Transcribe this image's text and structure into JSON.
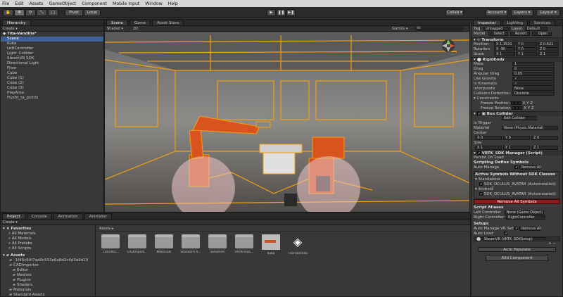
{
  "menu": [
    "File",
    "Edit",
    "Assets",
    "GameObject",
    "Component",
    "Mobile Input",
    "Window",
    "Help"
  ],
  "toolbar": {
    "tools": [
      "✋",
      "✥",
      "⟳",
      "⤡",
      "▢"
    ],
    "pivot": "Pivot",
    "local": "Local",
    "play": "▶",
    "pause": "❚❚",
    "step": "▶❚",
    "collab": "Collab ▾",
    "account": "Account ▾",
    "layers": "Layers ▾",
    "layout": "Layout ▾"
  },
  "hierarchy": {
    "tab": "Hierarchy",
    "create": "Create ▾",
    "scene": "Tita-Vandilla*",
    "items": [
      {
        "label": "Scene",
        "indent": 1,
        "selected": true
      },
      {
        "label": "Kuka",
        "indent": 1
      },
      {
        "label": "LeftController",
        "indent": 1
      },
      {
        "label": "Light_Collider",
        "indent": 1
      },
      {
        "label": "SteamVR SDK",
        "indent": 1
      },
      {
        "label": "Directional Light",
        "indent": 1
      },
      {
        "label": "Floor",
        "indent": 1
      },
      {
        "label": "Cube",
        "indent": 1
      },
      {
        "label": "Cube (1)",
        "indent": 1
      },
      {
        "label": "Cube (2)",
        "indent": 1
      },
      {
        "label": "Cube (3)",
        "indent": 1
      },
      {
        "label": "PlayArea",
        "indent": 1
      },
      {
        "label": "Flysht_ta_points",
        "indent": 1
      }
    ]
  },
  "scene": {
    "tabs": [
      "Scene",
      "Game",
      "Asset Store"
    ],
    "shaded": "Shaded ▾",
    "mode2d": "2D",
    "gizmos": "Gizmos ▾",
    "search": "All"
  },
  "inspector": {
    "tabs": [
      "Inspector",
      "Lighting",
      "Services"
    ],
    "tag_label": "Tag",
    "tag": "Untagged",
    "layer_label": "Layer",
    "layer": "Default",
    "model_label": "Model",
    "model_buttons": [
      "Select",
      "Revert",
      "Open"
    ],
    "transform": {
      "title": "Transform",
      "rows": [
        {
          "label": "Position",
          "x": "X 1.3531",
          "y": "Y 0",
          "z": "Z 0.621"
        },
        {
          "label": "Rotation",
          "x": "X -90",
          "y": "Y 0",
          "z": "Z 0"
        },
        {
          "label": "Scale",
          "x": "X 1",
          "y": "Y 1",
          "z": "Z 1"
        }
      ]
    },
    "rigidbody": {
      "title": "Rigidbody",
      "rows": [
        {
          "label": "Mass",
          "value": "1"
        },
        {
          "label": "Drag",
          "value": "0"
        },
        {
          "label": "Angular Drag",
          "value": "0.05"
        },
        {
          "label": "Use Gravity",
          "value": "✓"
        },
        {
          "label": "Is Kinematic",
          "value": "✓"
        },
        {
          "label": "Interpolate",
          "value": "None"
        },
        {
          "label": "Collision Detection",
          "value": "Discrete"
        }
      ],
      "constraints": "Constraints",
      "freeze_position": "Freeze Position",
      "freeze_rotation": "Freeze Rotation",
      "xyz": "X  Y  Z"
    },
    "box_collider": {
      "title": "Box Collider",
      "edit": "Edit Collider",
      "is_trigger": "Is Trigger",
      "material_label": "Material",
      "material": "None (Physic Material)",
      "center_label": "Center",
      "center": [
        "X 0",
        "Y 0",
        "Z 0"
      ],
      "size_label": "Size",
      "size": [
        "X 1",
        "Y 1",
        "Z 1"
      ]
    },
    "vrtk": {
      "title": "VRTK_SDK Manager (Script)",
      "persist": "Persist On Load",
      "scripting": "Scripting Define Symbols",
      "auto_manage": "Auto Manage",
      "remove_hint": "Remove All",
      "active_symbols": "Active Symbols Without SDK Classes",
      "standalone": "Standalone",
      "sym1": "SDK_OCULUS_AVATAR (Autoinstalled)",
      "android": "Android",
      "sym2": "SDK_OCULUS_AVATAR (Autoinstalled)",
      "remove_all": "Remove All Symbols",
      "script_aliases": "Script Aliases",
      "left_ctrl_label": "Left Controller",
      "left_ctrl": "None (Game Object)",
      "right_ctrl_label": "Right Controller",
      "right_ctrl": "RightController",
      "setups": "Setups",
      "auto_vr": "Auto Manage VR Set",
      "auto_load": "Auto Load",
      "setup_item": "SteamVR (VRTK_SDKSetup)",
      "auto_populate": "Auto Populate",
      "add_component": "Add Component"
    }
  },
  "project": {
    "tabs": [
      "Project",
      "Console",
      "Animation",
      "Animator"
    ],
    "create": "Create ▾",
    "favorites": "Favorites",
    "fav_items": [
      "All Materials",
      "All Models",
      "All Prefabs",
      "All Scripts"
    ],
    "assets_root": "Assets",
    "tree": [
      "_1f45c64f7ad0c553e6a8d2c4d3a9d10",
      "CADImporter",
      "Editor",
      "Meshes",
      "Plugins",
      "Shaders",
      "Materials",
      "Standard Assets"
    ],
    "breadcrumb": "Assets ▸",
    "grid": [
      {
        "label": "7145965...",
        "kind": "folder"
      },
      {
        "label": "CADImport...",
        "kind": "folder"
      },
      {
        "label": "Materials",
        "kind": "folder"
      },
      {
        "label": "Standard A...",
        "kind": "folder"
      },
      {
        "label": "SteamVR",
        "kind": "folder"
      },
      {
        "label": "VRTK-mas...",
        "kind": "folder"
      },
      {
        "label": "kuka",
        "kind": "model"
      },
      {
        "label": "Tita-Vandilla",
        "kind": "unity"
      }
    ]
  },
  "colors": {
    "accent": "#3e6296",
    "outline": "#f5a00a",
    "robot": "#d9531f",
    "remove": "#8b1d1d"
  }
}
